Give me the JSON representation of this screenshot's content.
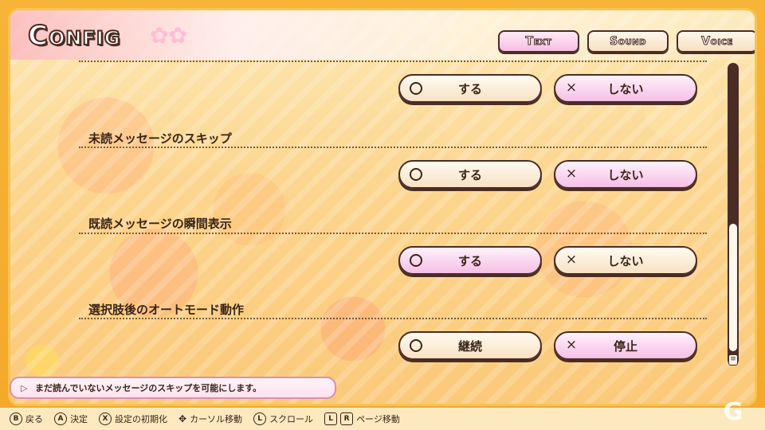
{
  "header": {
    "title": "Config",
    "tabs": [
      {
        "label": "Text",
        "active": true
      },
      {
        "label": "Sound",
        "active": false
      },
      {
        "label": "Voice",
        "active": false
      }
    ]
  },
  "options": [
    {
      "label": "",
      "yes": "する",
      "no": "しない",
      "selected": "no"
    },
    {
      "label": "未読メッセージのスキップ",
      "yes": "する",
      "no": "しない",
      "selected": "no"
    },
    {
      "label": "既読メッセージの瞬間表示",
      "yes": "する",
      "no": "しない",
      "selected": "yes"
    },
    {
      "label": "選択肢後のオートモード動作",
      "yes": "継続",
      "no": "停止",
      "selected": "no"
    }
  ],
  "symbols": {
    "yes": "○",
    "no": "×"
  },
  "hint": {
    "text": "まだ読んでいないメッセージのスキップを可能にします。"
  },
  "footer": [
    {
      "key": "B",
      "label": "戻る"
    },
    {
      "key": "A",
      "label": "決定"
    },
    {
      "key": "X",
      "label": "設定の初期化"
    },
    {
      "key": "✥",
      "label": "カーソル移動"
    },
    {
      "key": "L",
      "label": "スクロール"
    },
    {
      "key": "L",
      "key2": "R",
      "label": "ページ移動"
    }
  ],
  "scrollbar": {
    "position_fraction": 0.6
  },
  "colors": {
    "accent_pink": "#f5bfe6",
    "outline": "#4a2c24",
    "background": "#fcd58e"
  }
}
